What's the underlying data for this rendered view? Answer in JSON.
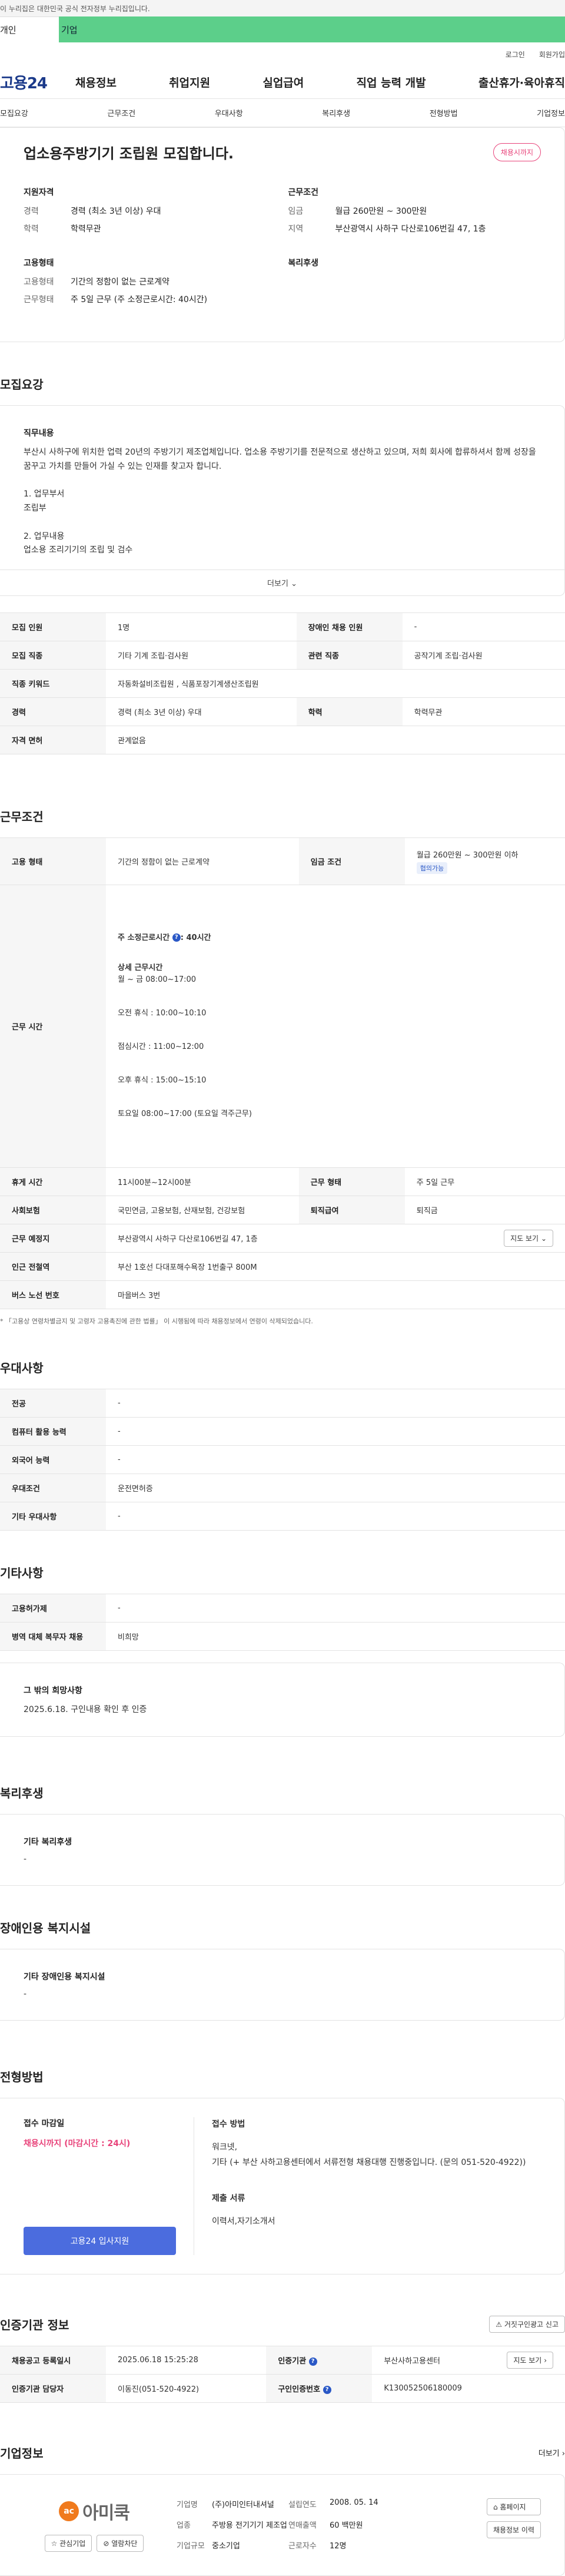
{
  "gov_banner": "이 누리집은 대한민국 공식 전자정부 누리집입니다.",
  "site_tabs": {
    "personal": "개인",
    "company": "기업"
  },
  "util": {
    "login": "로그인",
    "signup": "회원가입"
  },
  "gnb": {
    "logo": "고용24",
    "menu": [
      "채용정보",
      "취업지원",
      "실업급여",
      "직업 능력 개발",
      "출산휴가·육아휴직"
    ]
  },
  "anchor_nav": [
    "모집요강",
    "근무조건",
    "우대사항",
    "복리후생",
    "전형방법",
    "기업정보"
  ],
  "summary": {
    "title": "업소용주방기기 조립원 모집합니다.",
    "badge": "채용시까지",
    "qualification": {
      "heading": "지원자격",
      "rows": [
        {
          "k": "경력",
          "v": "경력 (최소 3년 이상) 우대"
        },
        {
          "k": "학력",
          "v": "학력무관"
        }
      ]
    },
    "conditions": {
      "heading": "근무조건",
      "rows": [
        {
          "k": "임금",
          "v": "월급 260만원 ~ 300만원"
        },
        {
          "k": "지역",
          "v": "부산광역시 사하구 다산로106번길 47, 1층"
        }
      ]
    },
    "employment": {
      "heading": "고용형태",
      "rows": [
        {
          "k": "고용형태",
          "v": "기간의 정함이 없는 근로계약"
        },
        {
          "k": "근무형태",
          "v": "주 5일 근무 (주 소정근로시간: 40시간)"
        }
      ]
    },
    "welfare": {
      "heading": "복리후생"
    }
  },
  "recruit": {
    "title": "모집요강",
    "desc_heading": "직무내용",
    "desc_text": "부산시 사하구에 위치한 업력 20년의 주방기기 제조업체입니다. 업소용 주방기기를 전문적으로 생산하고 있으며, 저희 회사에 합류하셔서 함께 성장을 꿈꾸고 가치를 만들어 가실 수 있는 인재를 찾고자 합니다.",
    "task1_title": "1. 업무부서",
    "task1_value": "조립부",
    "task2_title": "2. 업무내용",
    "task2_value": "업소용 조리기기의 조립 및 검수",
    "more": "더보기",
    "table": {
      "r1": {
        "k1": "모집 인원",
        "v1": "1명",
        "k2": "장애인 채용 인원",
        "v2": "-"
      },
      "r2": {
        "k1": "모집 직종",
        "v1": "기타 기계 조립·검사원",
        "k2": "관련 직종",
        "v2": "공작기계 조립·검사원"
      },
      "r3": {
        "k1": "직종 키워드",
        "v1": "자동화설비조립원 , 식품포장기계생산조립원"
      },
      "r4": {
        "k1": "경력",
        "v1": "경력 (최소 3년 이상) 우대",
        "k2": "학력",
        "v2": "학력무관"
      },
      "r5": {
        "k1": "자격 면허",
        "v1": "관계없음"
      }
    }
  },
  "work": {
    "title": "근무조건",
    "employment_type": {
      "k": "고용 형태",
      "v": "기간의 정함이 없는 근로계약"
    },
    "wage": {
      "k": "임금 조건",
      "v": "월급 260만원 ~ 300만원 이하",
      "chip": "협의가능"
    },
    "hours_k": "근무 시간",
    "hours": {
      "weekly": "주 소정근로시간",
      "weekly_value": ": 40시간",
      "detail_title": "상세 근무시간",
      "days": "월 ~ 금 08:00~17:00",
      "break1": "오전 휴식 : 10:00~10:10",
      "lunch": "점심시간 : 11:00~12:00",
      "break2": "오후 휴식 : 15:00~15:10",
      "saturday": "토요일 08:00~17:00 (토요일 격주근무)"
    },
    "rest": {
      "k1": "휴게 시간",
      "v1": "11시00분~12시00분",
      "k2": "근무 형태",
      "v2": "주 5일 근무"
    },
    "insurance": {
      "k1": "사회보험",
      "v1": "국민연금, 고용보험, 산재보험, 건강보험",
      "k2": "퇴직급여",
      "v2": "퇴직금"
    },
    "location": {
      "k": "근무 예정지",
      "v": "부산광역시 사하구 다산로106번길 47, 1층",
      "btn": "지도 보기"
    },
    "subway": {
      "k": "인근 전철역",
      "v": "부산 1호선 다대포해수욕장 1번출구 800M"
    },
    "bus": {
      "k": "버스 노선 번호",
      "v": "마을버스 3번"
    },
    "note": "* 「고용상 연령차별금지 및 고령자 고용촉진에 관한 법률」 이 시행됨에 따라 채용정보에서 연령이 삭제되었습니다."
  },
  "preference": {
    "title": "우대사항",
    "rows": [
      {
        "k": "전공",
        "v": "-"
      },
      {
        "k": "컴퓨터 활용 능력",
        "v": "-"
      },
      {
        "k": "외국어 능력",
        "v": "-"
      },
      {
        "k": "우대조건",
        "v": "운전면허증"
      },
      {
        "k": "기타 우대사항",
        "v": "-"
      }
    ]
  },
  "etc": {
    "title": "기타사항",
    "rows": [
      {
        "k": "고용허가제",
        "v": "-"
      },
      {
        "k": "병역 대체 복무자 채용",
        "v": "비희망"
      }
    ],
    "hope_title": "그 밖의 희망사항",
    "hope_value": "2025.6.18. 구인내용 확인 후 인증"
  },
  "welfare": {
    "title": "복리후생",
    "card_title": "기타 복리후생",
    "card_value": "-"
  },
  "disability": {
    "title": "장애인용 복지시설",
    "card_title": "기타 장애인용 복지시설",
    "card_value": "-"
  },
  "selection": {
    "title": "전형방법",
    "deadline_title": "접수 마감일",
    "deadline_value": "채용시까지 (마감시간 : 24시)",
    "apply_btn": "고용24 입사지원",
    "method_title": "접수 방법",
    "method_value": "워크넷,",
    "method_detail": "기타 (+ 부산 사하고용센터에서 서류전형 채용대행 진행중입니다. (문의 051-520-4922))",
    "docs_title": "제출 서류",
    "docs_value": "이력서,자기소개서"
  },
  "agency": {
    "title": "인증기관 정보",
    "report_btn": "거짓구인광고 신고",
    "r1": {
      "k1": "채용공고 등록일시",
      "v1": "2025.06.18 15:25:28",
      "k2": "인증기관",
      "v2": "부산사하고용센터",
      "btn": "지도 보기"
    },
    "r2": {
      "k1": "인증기관 담당자",
      "v1": "이동진(051-520-4922)",
      "k2": "구인인증번호",
      "v2": "K130052506180009"
    }
  },
  "company": {
    "title": "기업정보",
    "more": "더보기",
    "logo_mark": "ac",
    "logo_text": "아미쿡",
    "fav_btn": "관심기업",
    "follow_btn": "열람차단",
    "info": [
      {
        "k": "기업명",
        "v": "(주)아미인터내셔널",
        "k2": "설립연도",
        "v2": "2008. 05. 14"
      },
      {
        "k": "업종",
        "v": "주방용 전기기기 제조업",
        "k2": "연매출액",
        "v2": "60 백만원"
      },
      {
        "k": "기업규모",
        "v": "중소기업",
        "k2": "근로자수",
        "v2": "12명"
      }
    ],
    "homepage_btn": "홈페이지",
    "history_btn": "채용정보 이력"
  }
}
